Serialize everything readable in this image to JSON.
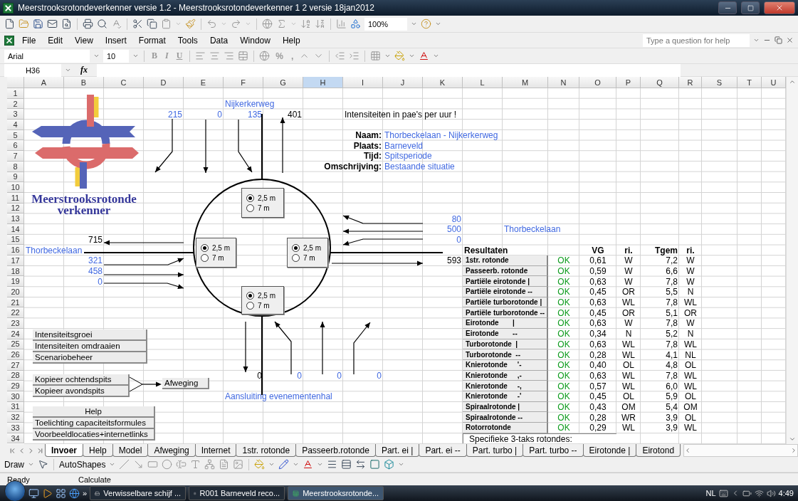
{
  "window": {
    "title": "Meerstrooksrotondeverkenner versie 1.2 - Meerstrooksrotondeverkenner 1 2 versie 18jan2012"
  },
  "standard_toolbar": {
    "zoom": "100%"
  },
  "menu": [
    "File",
    "Edit",
    "View",
    "Insert",
    "Format",
    "Tools",
    "Data",
    "Window",
    "Help"
  ],
  "help_search": {
    "placeholder": "Type a question for help"
  },
  "formatting_toolbar": {
    "font": "Arial",
    "size": "10",
    "style_buttons": [
      "B",
      "I",
      "U"
    ],
    "number_buttons": [
      "%",
      ","
    ]
  },
  "formula_bar": {
    "name_box": "H36",
    "function_label": "fx"
  },
  "columns": [
    {
      "label": "A",
      "selected": false
    },
    {
      "label": "B",
      "selected": false
    },
    {
      "label": "C",
      "selected": false
    },
    {
      "label": "D",
      "selected": false
    },
    {
      "label": "E",
      "selected": false
    },
    {
      "label": "F",
      "selected": false
    },
    {
      "label": "G",
      "selected": false
    },
    {
      "label": "H",
      "selected": true
    },
    {
      "label": "I",
      "selected": false
    },
    {
      "label": "J",
      "selected": false
    },
    {
      "label": "K",
      "selected": false
    },
    {
      "label": "L",
      "selected": false
    },
    {
      "label": "M",
      "selected": false
    },
    {
      "label": "N",
      "selected": false
    },
    {
      "label": "O",
      "selected": false
    },
    {
      "label": "P",
      "selected": false
    },
    {
      "label": "Q",
      "selected": false
    },
    {
      "label": "R",
      "selected": false
    },
    {
      "label": "S",
      "selected": false
    },
    {
      "label": "T",
      "selected": false
    },
    {
      "label": "U",
      "selected": false
    }
  ],
  "rows": [
    "1",
    "2",
    "3",
    "4",
    "5",
    "6",
    "7",
    "8",
    "9",
    "10",
    "11",
    "12",
    "13",
    "14",
    "15",
    "16",
    "17",
    "18",
    "19",
    "20",
    "21",
    "22",
    "23",
    "24",
    "25",
    "26",
    "27",
    "28",
    "29",
    "30",
    "31",
    "32",
    "33",
    "34"
  ],
  "sheet": {
    "logo_text": "Meerstrooksrotonde verkenner",
    "north": {
      "name": "Nijkerkerweg",
      "in": [
        "215",
        "0",
        "135"
      ],
      "out": "401"
    },
    "note": "Intensiteiten in pae's per uur !",
    "info": [
      {
        "label": "Naam:",
        "value": "Thorbeckelaan - Nijkerkerweg"
      },
      {
        "label": "Plaats:",
        "value": "Barneveld"
      },
      {
        "label": "Tijd:",
        "value": "Spitsperiode"
      },
      {
        "label": "Omschrijving:",
        "value": "Bestaande situatie"
      }
    ],
    "lane_selectors": [
      {
        "options": [
          {
            "label": "2,5 m",
            "selected": true
          },
          {
            "label": "7 m",
            "selected": false
          }
        ]
      },
      {
        "options": [
          {
            "label": "2,5 m",
            "selected": true
          },
          {
            "label": "7 m",
            "selected": false
          }
        ]
      },
      {
        "options": [
          {
            "label": "2,5 m",
            "selected": true
          },
          {
            "label": "7 m",
            "selected": false
          }
        ]
      },
      {
        "options": [
          {
            "label": "2,5 m",
            "selected": true
          },
          {
            "label": "7 m",
            "selected": false
          }
        ]
      }
    ],
    "east": {
      "in": [
        "80",
        "500",
        "0"
      ],
      "name": "Thorbeckelaan",
      "out": "593"
    },
    "west": {
      "out": "715",
      "name": "Thorbeckelaan",
      "in": [
        "321",
        "458",
        "0"
      ]
    },
    "south": {
      "out": "0",
      "in": [
        "0",
        "0",
        "0"
      ],
      "name": "Aansluiting evenementenhal"
    },
    "results": {
      "headers": [
        "Resultaten",
        "VG",
        "ri.",
        "Tgem",
        "ri."
      ],
      "rows": [
        {
          "name": "1str. rotonde",
          "status": "OK",
          "vg": "0,61",
          "ri_vg": "W",
          "tgem": "7,2",
          "ri_tgem": "W"
        },
        {
          "name": "Passeerb. rotonde",
          "status": "OK",
          "vg": "0,59",
          "ri_vg": "W",
          "tgem": "6,6",
          "ri_tgem": "W"
        },
        {
          "name": "Partiële eirotonde |",
          "status": "OK",
          "vg": "0,63",
          "ri_vg": "W",
          "tgem": "7,8",
          "ri_tgem": "W"
        },
        {
          "name": "Partiële eirotonde --",
          "status": "OK",
          "vg": "0,45",
          "ri_vg": "OR",
          "tgem": "5,5",
          "ri_tgem": "N"
        },
        {
          "name": "Partiële turborotonde |",
          "status": "OK",
          "vg": "0,63",
          "ri_vg": "WL",
          "tgem": "7,8",
          "ri_tgem": "WL"
        },
        {
          "name": "Partiële turborotonde --",
          "status": "OK",
          "vg": "0,45",
          "ri_vg": "OR",
          "tgem": "5,1",
          "ri_tgem": "OR"
        },
        {
          "name": "Eirotonde       |",
          "status": "OK",
          "vg": "0,63",
          "ri_vg": "W",
          "tgem": "7,8",
          "ri_tgem": "W"
        },
        {
          "name": "Eirotonde       --",
          "status": "OK",
          "vg": "0,34",
          "ri_vg": "N",
          "tgem": "5,2",
          "ri_tgem": "N"
        },
        {
          "name": "Turborotonde  |",
          "status": "OK",
          "vg": "0,63",
          "ri_vg": "WL",
          "tgem": "7,8",
          "ri_tgem": "WL"
        },
        {
          "name": "Turborotonde  --",
          "status": "OK",
          "vg": "0,28",
          "ri_vg": "WL",
          "tgem": "4,1",
          "ri_tgem": "NL"
        },
        {
          "name": "Knierotonde     '-",
          "status": "OK",
          "vg": "0,40",
          "ri_vg": "OL",
          "tgem": "4,8",
          "ri_tgem": "OL"
        },
        {
          "name": "Knierotonde     ,-",
          "status": "OK",
          "vg": "0,63",
          "ri_vg": "WL",
          "tgem": "7,8",
          "ri_tgem": "WL"
        },
        {
          "name": "Knierotonde     -,",
          "status": "OK",
          "vg": "0,57",
          "ri_vg": "WL",
          "tgem": "6,0",
          "ri_tgem": "WL"
        },
        {
          "name": "Knierotonde     -'",
          "status": "OK",
          "vg": "0,45",
          "ri_vg": "OL",
          "tgem": "5,9",
          "ri_tgem": "OL"
        },
        {
          "name": "Spiraalrotonde |",
          "status": "OK",
          "vg": "0,43",
          "ri_vg": "OM",
          "tgem": "5,4",
          "ri_tgem": "OM"
        },
        {
          "name": "Spiraalrotonde --",
          "status": "OK",
          "vg": "0,28",
          "ri_vg": "WR",
          "tgem": "3,9",
          "ri_tgem": "OL"
        },
        {
          "name": "Rotorrotonde",
          "status": "OK",
          "vg": "0,29",
          "ri_vg": "WL",
          "tgem": "3,9",
          "ri_tgem": "WL"
        }
      ],
      "footer": "Specifieke 3-taks rotondes:"
    },
    "macro_groups": [
      {
        "buttons": [
          "Intensiteitsgroei",
          "Intensiteiten omdraaien",
          "Scenariobeheer"
        ]
      },
      {
        "buttons": [
          "Kopieer ochtendspits",
          "Kopieer avondspits"
        ]
      },
      {
        "buttons": [
          "Afweging"
        ]
      },
      {
        "buttons": [
          "Help",
          "Toelichting capaciteitsformules",
          "Voorbeeldlocaties+internetlinks"
        ]
      }
    ]
  },
  "sheet_tabs": [
    {
      "label": "Invoer",
      "selected": true
    },
    {
      "label": "Help",
      "selected": false
    },
    {
      "label": "Model",
      "selected": false
    },
    {
      "label": "Afweging",
      "selected": false
    },
    {
      "label": "Internet",
      "selected": false
    },
    {
      "label": "1str. rotonde",
      "selected": false
    },
    {
      "label": "Passeerb.rotonde",
      "selected": false
    },
    {
      "label": "Part. ei |",
      "selected": false
    },
    {
      "label": "Part. ei --",
      "selected": false
    },
    {
      "label": "Part. turbo |",
      "selected": false
    },
    {
      "label": "Part. turbo --",
      "selected": false
    },
    {
      "label": "Eirotonde |",
      "selected": false
    },
    {
      "label": "Eirotond",
      "selected": false
    }
  ],
  "draw_toolbar": {
    "draw": "Draw",
    "autoshapes": "AutoShapes"
  },
  "status_bar": {
    "state": "Ready",
    "mode": "Calculate"
  },
  "taskbar": {
    "more": "»",
    "items": [
      {
        "label": "Verwisselbare schijf ...",
        "selected": false,
        "kind": "drive"
      },
      {
        "label": "R001 Barneveld reco...",
        "selected": false,
        "kind": "word"
      },
      {
        "label": "Meerstrooksrotonde...",
        "selected": true,
        "kind": "excel"
      }
    ],
    "language": "NL",
    "clock": "4:49"
  }
}
